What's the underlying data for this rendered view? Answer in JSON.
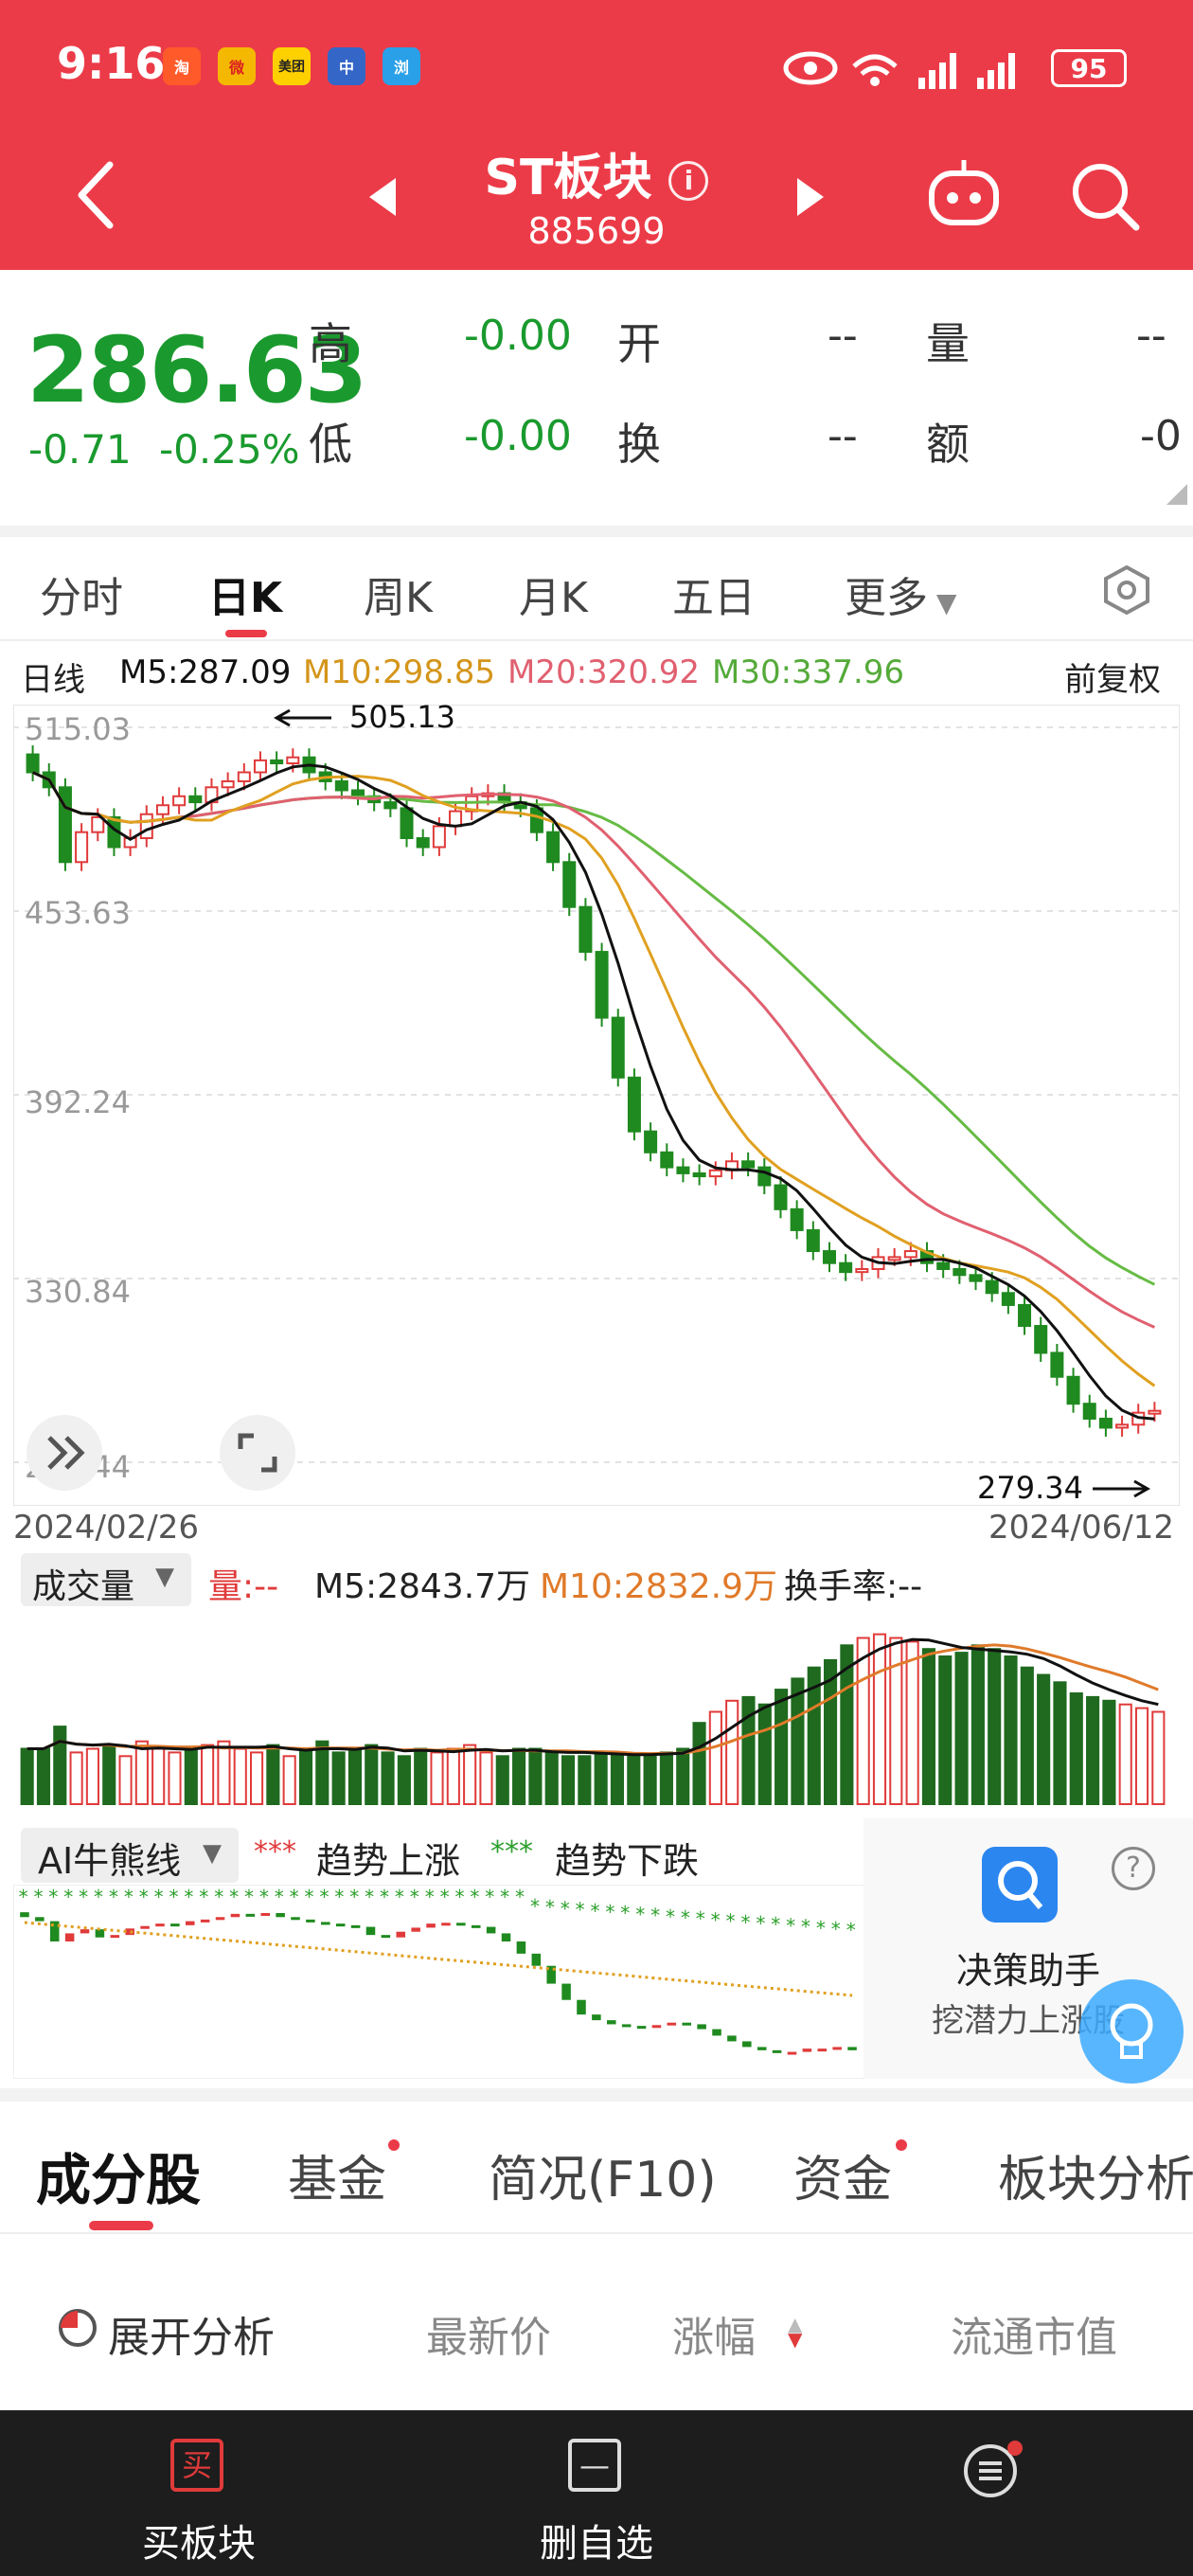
{
  "status": {
    "time": "9:16",
    "battery": "95",
    "apps": [
      "淘",
      "微",
      "美团",
      "中",
      "浏"
    ]
  },
  "header": {
    "title": "ST板块",
    "code": "885699"
  },
  "quote": {
    "price": "286.63",
    "change": "-0.71",
    "change_pct": "-0.25%",
    "labels": {
      "high": "高",
      "low": "低",
      "open": "开",
      "turnover": "换",
      "volume": "量",
      "amount": "额"
    },
    "high": "-0.00",
    "low": "-0.00",
    "open": "--",
    "turnover": "--",
    "volume": "--",
    "amount": "-0"
  },
  "tabs": [
    "分时",
    "日K",
    "周K",
    "月K",
    "五日",
    "更多"
  ],
  "ma": {
    "period": "日线",
    "m5": "M5:287.09",
    "m10": "M10:298.85",
    "m20": "M20:320.92",
    "m30": "M30:337.96",
    "adjust": "前复权",
    "colors": {
      "m5": "#111111",
      "m10": "#e0a020",
      "m20": "#e06070",
      "m30": "#66bb44"
    }
  },
  "chart_data": {
    "type": "candlestick",
    "y_ticks": [
      "515.03",
      "453.63",
      "392.24",
      "330.84",
      "269.44"
    ],
    "ylim": [
      269.44,
      515.03
    ],
    "high_label": "505.13",
    "low_label": "279.34",
    "start_date": "2024/02/26",
    "end_date": "2024/06/12",
    "closes": [
      500,
      495,
      470,
      480,
      485,
      475,
      478,
      486,
      489,
      492,
      490,
      495,
      497,
      500,
      504,
      503,
      505,
      500,
      497,
      494,
      492,
      490,
      488,
      478,
      475,
      482,
      487,
      492,
      493,
      490,
      488,
      480,
      470,
      455,
      440,
      418,
      398,
      380,
      373,
      368,
      366,
      365,
      367,
      370,
      368,
      362,
      354,
      347,
      340,
      336,
      333,
      334,
      338,
      338,
      340,
      336,
      334,
      332,
      330,
      326,
      322,
      315,
      306,
      298,
      289,
      284,
      281,
      282,
      286,
      286.63
    ],
    "volume_legend": {
      "label": "成交量",
      "vol": "量:--",
      "m5": "M5:2843.7万",
      "m10": "M10:2832.9万",
      "turnover": "换手率:--"
    },
    "volumes": [
      30,
      30,
      42,
      28,
      30,
      32,
      26,
      34,
      30,
      28,
      30,
      32,
      34,
      30,
      28,
      32,
      26,
      30,
      34,
      28,
      30,
      32,
      28,
      26,
      30,
      28,
      30,
      32,
      28,
      26,
      30,
      30,
      28,
      26,
      26,
      28,
      28,
      26,
      26,
      28,
      30,
      44,
      50,
      56,
      58,
      54,
      62,
      68,
      74,
      78,
      86,
      90,
      92,
      90,
      88,
      84,
      80,
      82,
      86,
      84,
      80,
      74,
      70,
      66,
      60,
      58,
      56,
      54,
      52,
      50
    ],
    "ai_legend": {
      "label": "AI牛熊线",
      "up": "趋势上涨",
      "down": "趋势下跌"
    }
  },
  "helper": {
    "title": "决策助手",
    "subtitle": "挖潜力上涨股"
  },
  "section_tabs": [
    "成分股",
    "基金",
    "简况(F10)",
    "资金",
    "板块分析"
  ],
  "columns": {
    "expand": "展开分析",
    "latest": "最新价",
    "change": "涨幅",
    "float_cap": "流通市值"
  },
  "bottom": {
    "buy": "买板块",
    "buy_icon": "买",
    "remove": "删自选"
  }
}
